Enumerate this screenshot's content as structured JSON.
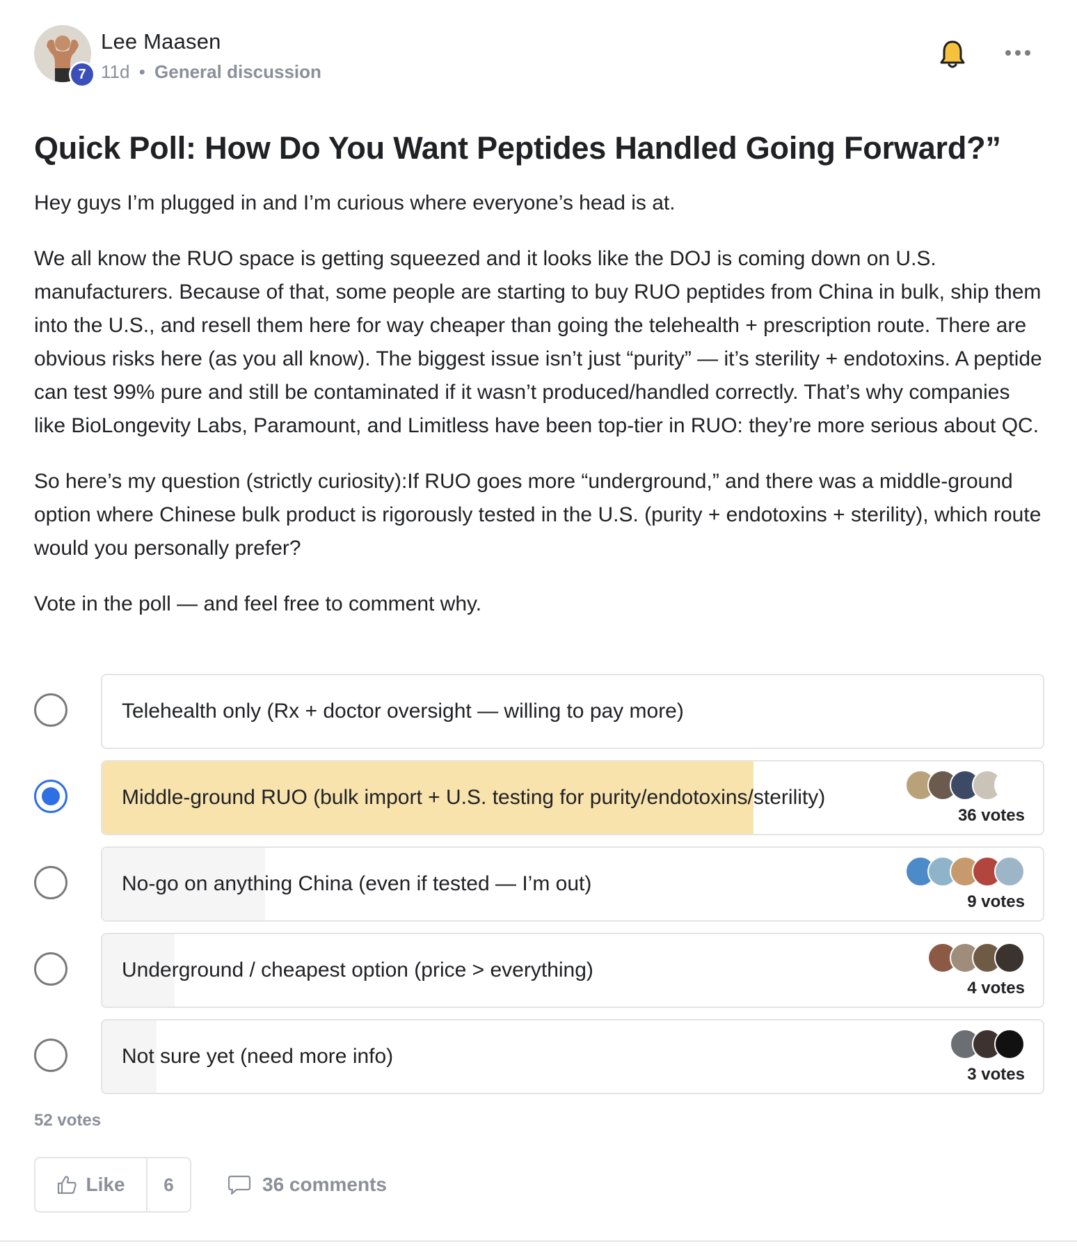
{
  "post": {
    "author": "Lee Maasen",
    "level": "7",
    "age": "11d",
    "separator": "•",
    "category": "General discussion",
    "title": "Quick Poll: How Do You Want Peptides Handled Going Forward?”",
    "paragraphs": [
      "Hey guys I’m plugged in and I’m curious where everyone’s head is at.",
      "We all know the RUO space is getting squeezed and it looks like the DOJ is coming down on U.S. manufacturers. Because of that, some people are starting to buy RUO peptides from China in bulk, ship them into the U.S., and resell them here for way cheaper than going the telehealth + prescription route. There are obvious risks here (as you all know). The biggest issue isn’t just “purity” — it’s sterility + endotoxins. A peptide can test 99% pure and still be contaminated if it wasn’t produced/handled correctly. That’s why companies like BioLongevity Labs, Paramount, and Limitless have been top-tier in RUO: they’re more serious about QC.",
      "So here’s my question (strictly curiosity):If RUO goes more “underground,” and there was a middle-ground option where Chinese bulk product is rigorously tested in the U.S. (purity + endotoxins + sterility), which route would you personally prefer?",
      "Vote in the poll — and feel free to comment why."
    ]
  },
  "poll": {
    "options": [
      {
        "label": "Telehealth only (Rx + doctor oversight — willing to pay more)",
        "votes": 0,
        "vote_text": "",
        "share": 0,
        "selected": false,
        "voter_colors": []
      },
      {
        "label": "Middle-ground RUO (bulk import + U.S. testing for purity/endotoxins/sterility)",
        "votes": 36,
        "vote_text": "36 votes",
        "share": 0.6923,
        "selected": true,
        "voter_colors": [
          "#b9a27a",
          "#6b5b4e",
          "#3d4a66",
          "#c9c3b8",
          "#ffffff"
        ]
      },
      {
        "label": "No-go on anything China (even if tested — I’m out)",
        "votes": 9,
        "vote_text": "9 votes",
        "share": 0.1731,
        "selected": false,
        "voter_colors": [
          "#4d8ac8",
          "#8fb3c9",
          "#c79a6e",
          "#b2463f",
          "#9cb6c8"
        ]
      },
      {
        "label": "Underground / cheapest option (price > everything)",
        "votes": 4,
        "vote_text": "4 votes",
        "share": 0.0769,
        "selected": false,
        "voter_colors": [
          "#8c5a44",
          "#a08c7a",
          "#6f5a46",
          "#3b332e"
        ]
      },
      {
        "label": "Not sure yet (need more info)",
        "votes": 3,
        "vote_text": "3 votes",
        "share": 0.0577,
        "selected": false,
        "voter_colors": [
          "#6b6f74",
          "#3d3230",
          "#111111"
        ]
      }
    ],
    "total_text": "52 votes"
  },
  "actions": {
    "like_label": "Like",
    "like_count": "6",
    "comments_label": "36 comments"
  },
  "colors": {
    "accent": "#2f6fe4",
    "winner_fill": "#f8e3ad",
    "badge": "#3b4fb8",
    "muted_text": "#8a8f98"
  }
}
